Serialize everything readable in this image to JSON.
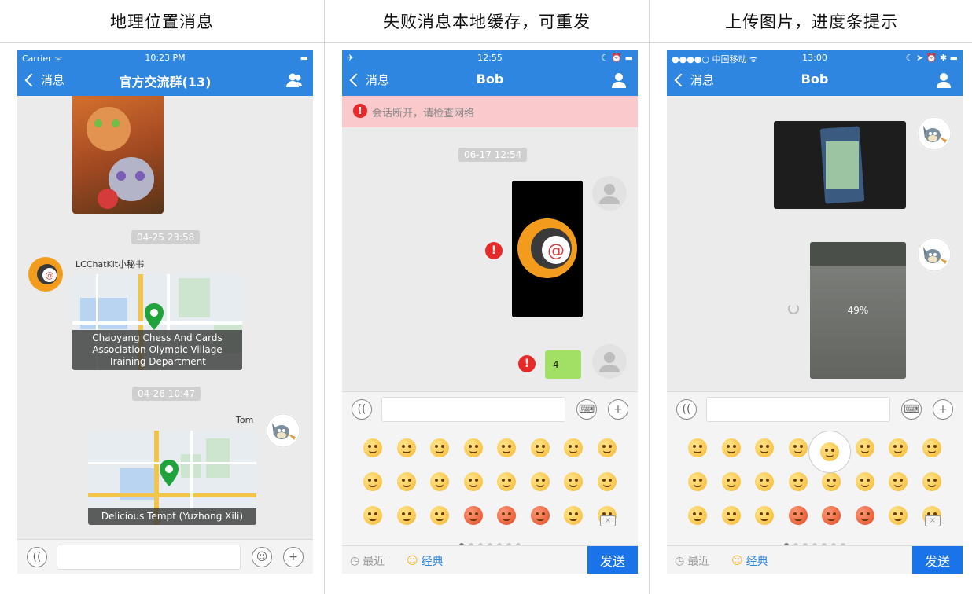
{
  "panels": [
    {
      "title": "地理位置消息",
      "status": {
        "left": "Carrier ᯤ",
        "time": "10:23 PM",
        "right": "▬"
      },
      "nav": {
        "back": "消息",
        "title": "官方交流群(13)"
      },
      "timestamps": [
        "04-25 23:58",
        "04-26 10:47"
      ],
      "sender_bot": "LCChatKit小秘书",
      "sender_tom": "Tom",
      "map1_caption": "Chaoyang Chess And Cards Association Olympic Village Training Department",
      "map2_caption": "Delicious Tempt (Yuzhong Xili)"
    },
    {
      "title": "失败消息本地缓存，可重发",
      "status": {
        "left": "✈",
        "time": "12:55",
        "right": "☾ ⏰ ▬"
      },
      "nav": {
        "back": "消息",
        "title": "Bob"
      },
      "banner": "会话断开，请检查网络",
      "timestamp": "06-17 12:54",
      "err_mark": "!",
      "text_msg": "4",
      "recent": "最近",
      "classic": "经典",
      "send": "发送"
    },
    {
      "title": "上传图片，进度条提示",
      "status": {
        "left": "●●●●○ 中国移动 ᯤ",
        "time": "13:00",
        "right": "☾ ➤ ⏰ ✱ ▬"
      },
      "nav": {
        "back": "消息",
        "title": "Bob"
      },
      "progress": "49%",
      "recent": "最近",
      "classic": "经典",
      "send": "发送"
    }
  ]
}
